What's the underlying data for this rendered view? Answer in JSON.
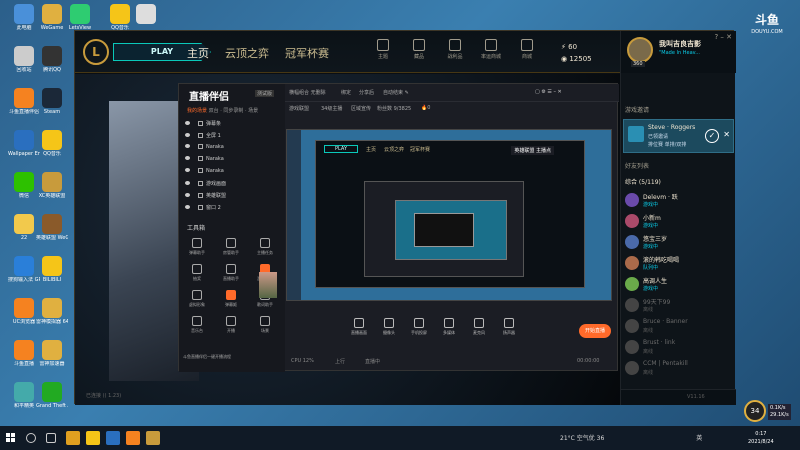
{
  "desktop": {
    "icons": [
      {
        "label": "此电脑",
        "color": "#4a90d9",
        "col": 0,
        "row": 0
      },
      {
        "label": "WeGame",
        "color": "#e0b040",
        "col": 1,
        "row": 0
      },
      {
        "label": "LetsView",
        "color": "#2ecc71",
        "col": 2,
        "row": 0
      },
      {
        "label": "QQ音乐",
        "color": "#f5c518",
        "col": 3,
        "row": 0
      },
      {
        "label": "",
        "color": "#ddd",
        "col": 4,
        "row": 0
      },
      {
        "label": "回收站",
        "color": "#ccc",
        "col": 0,
        "row": 1
      },
      {
        "label": "腾讯QQ",
        "color": "#333",
        "col": 1,
        "row": 1
      },
      {
        "label": "斗鱼直播伴侣",
        "color": "#f58220",
        "col": 0,
        "row": 2
      },
      {
        "label": "Steam",
        "color": "#1b2838",
        "col": 1,
        "row": 2
      },
      {
        "label": "Wallpaper Engine",
        "color": "#2a6fbf",
        "col": 0,
        "row": 3
      },
      {
        "label": "QQ音乐",
        "color": "#f5c518",
        "col": 1,
        "row": 3
      },
      {
        "label": "微信",
        "color": "#2dc100",
        "col": 0,
        "row": 4
      },
      {
        "label": "XC英雄联盟",
        "color": "#c89b3c",
        "col": 1,
        "row": 4
      },
      {
        "label": "22",
        "color": "#f2c94c",
        "col": 0,
        "row": 5
      },
      {
        "label": "英雄联盟 WeGame",
        "color": "#8a5a2a",
        "col": 1,
        "row": 5
      },
      {
        "label": "搜狗输入法 GP8",
        "color": "#2a7fd9",
        "col": 0,
        "row": 6
      },
      {
        "label": "BILIBILI",
        "color": "#f5c518",
        "col": 1,
        "row": 6
      },
      {
        "label": "UC浏览器",
        "color": "#f58220",
        "col": 0,
        "row": 7
      },
      {
        "label": "雷神模拟器 64",
        "color": "#e0b040",
        "col": 1,
        "row": 7
      },
      {
        "label": "斗鱼直播",
        "color": "#f58220",
        "col": 0,
        "row": 8
      },
      {
        "label": "雷神加速器",
        "color": "#e0b040",
        "col": 1,
        "row": 8
      },
      {
        "label": "和平精英",
        "color": "#4aa",
        "col": 0,
        "row": 9
      },
      {
        "label": "Grand Theft Auto V",
        "color": "#2a2",
        "col": 1,
        "row": 9
      }
    ]
  },
  "lol": {
    "play_label": "PLAY",
    "tabs": [
      "主页",
      "云顶之弈",
      "冠军杯赛"
    ],
    "toolbar": [
      "主题",
      "藏品",
      "战利品",
      "率运商城",
      "商城"
    ],
    "currency": {
      "be": "60",
      "rp": "12505"
    },
    "footer": "已连接 (( 1.23)"
  },
  "social": {
    "name": "我叫吉良吉影",
    "status": "\"Made In Heav...",
    "level": "360",
    "invite_title": "游戏邀请",
    "invite": {
      "name": "Steve · Roggers",
      "line1": "已领邀请",
      "line2": "排位赛 单排/双排"
    },
    "friends_title": "好友列表",
    "group": "综合 (5/119)",
    "friends": [
      {
        "name": "Delevm · 跃",
        "status": "游戏中",
        "online": true,
        "color": "#6a4aaa"
      },
      {
        "name": "小新m",
        "status": "游戏中",
        "online": true,
        "color": "#aa4a6a"
      },
      {
        "name": "悠宝三岁",
        "status": "游戏中",
        "online": true,
        "color": "#4a6aaa"
      },
      {
        "name": "滚的韩吃喝喝",
        "status": "队列中",
        "online": true,
        "color": "#aa6a4a"
      },
      {
        "name": "高调人生",
        "status": "游戏中",
        "online": true,
        "color": "#6aaa4a"
      },
      {
        "name": "99天下99",
        "status": "离线",
        "online": false,
        "color": "#444"
      },
      {
        "name": "Bruce · Banner",
        "status": "离线",
        "online": false,
        "color": "#444"
      },
      {
        "name": "Brust · link",
        "status": "离线",
        "online": false,
        "color": "#444"
      },
      {
        "name": "CCM | Pentakill",
        "status": "离线",
        "online": false,
        "color": "#444"
      }
    ],
    "version": "V11.16"
  },
  "stream": {
    "logo": "直播伴侣",
    "version": "测试版",
    "tabs": {
      "active": "我的场景",
      "others": "双台 · 同步录制 · 场景"
    },
    "scenes": [
      "弹幕条",
      "全屏 1",
      "Naraka",
      "Naraka",
      "Naraka",
      "游戏画面",
      "英雄联盟",
      "窗口 2"
    ],
    "tools_label": "工具箱",
    "tools": [
      "弹幕助手",
      "房管助手",
      "主播任务",
      "抽奖",
      "直播助手",
      "游戏助手",
      "虚拟形象",
      "弹幕姬",
      "歌词助手",
      "音乐台",
      "开播",
      "场景"
    ],
    "warn": "斗鱼直播伴侣一键开播流程",
    "top_items": [
      "横幅组合 无删除",
      "绑定",
      "分享后",
      "自动结束 ✎"
    ],
    "top2_items": [
      "游戏联盟",
      "34级主播",
      "区域宣传",
      "粉丝数 9/3825",
      "🔥0"
    ],
    "preview_tabs": [
      "主页",
      "云顶之弈",
      "冠军杯赛"
    ],
    "preview_caption": "英雄联盟 主播点",
    "controls": [
      "直播画面",
      "摄像头",
      "手机投屏",
      "多媒体",
      "麦克风",
      "扬声器"
    ],
    "start_live": "开始直播",
    "status": [
      "CPU 12%",
      "上行",
      "直播中",
      "00:00:00"
    ]
  },
  "brand": {
    "big": "斗鱼",
    "small": "DOUYU.COM"
  },
  "taskbar": {
    "weather": "21°C 空气优 36",
    "ime": "英",
    "time": "0:17",
    "date": "2021/8/24"
  },
  "speed": {
    "percent": "34",
    "up": "0.1K/s",
    "down": "29.1K/s"
  }
}
